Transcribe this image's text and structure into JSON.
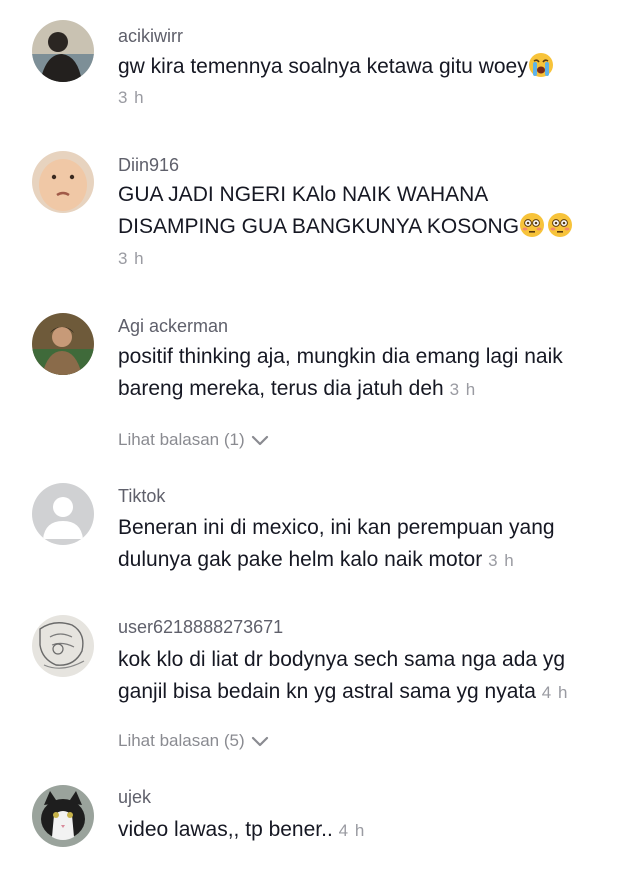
{
  "comments": [
    {
      "username": "acikiwirr",
      "text_lines": [
        "gw kira temennya soalnya ketawa gitu woey"
      ],
      "emoji": "loudly-crying-face",
      "time": "3 h"
    },
    {
      "username": "Diin916",
      "text_lines": [
        "GUA JADI NGERI KAlo NAIK WAHANA",
        "DISAMPING GUA BANGKUNYA KOSONG"
      ],
      "emoji": "flushed-face-x2",
      "time": "3 h"
    },
    {
      "username": "Agi ackerman",
      "text_lines": [
        "positif thinking aja, mungkin dia emang lagi naik",
        "bareng mereka, terus dia jatuh deh"
      ],
      "time": "3 h",
      "replies_label": "Lihat balasan (1)"
    },
    {
      "username": "Tiktok",
      "text_lines": [
        "Beneran ini di mexico, ini kan perempuan yang",
        "dulunya gak pake helm kalo naik motor"
      ],
      "time": "3 h"
    },
    {
      "username": "user6218888273671",
      "text_lines": [
        "kok klo di liat dr bodynya sech sama nga ada yg",
        "ganjil bisa bedain kn yg astral sama yg nyata"
      ],
      "time": "4 h",
      "replies_label": "Lihat balasan (5)"
    },
    {
      "username": "ujek",
      "text_lines": [
        "video lawas,, tp bener.."
      ],
      "time": "4 h"
    }
  ],
  "colors": {
    "username": "#5f606b",
    "text": "#161823",
    "time": "#9a9ba2",
    "replies": "#8a8b91"
  },
  "icons": {
    "replies_chevron": "chevron-down-icon"
  }
}
